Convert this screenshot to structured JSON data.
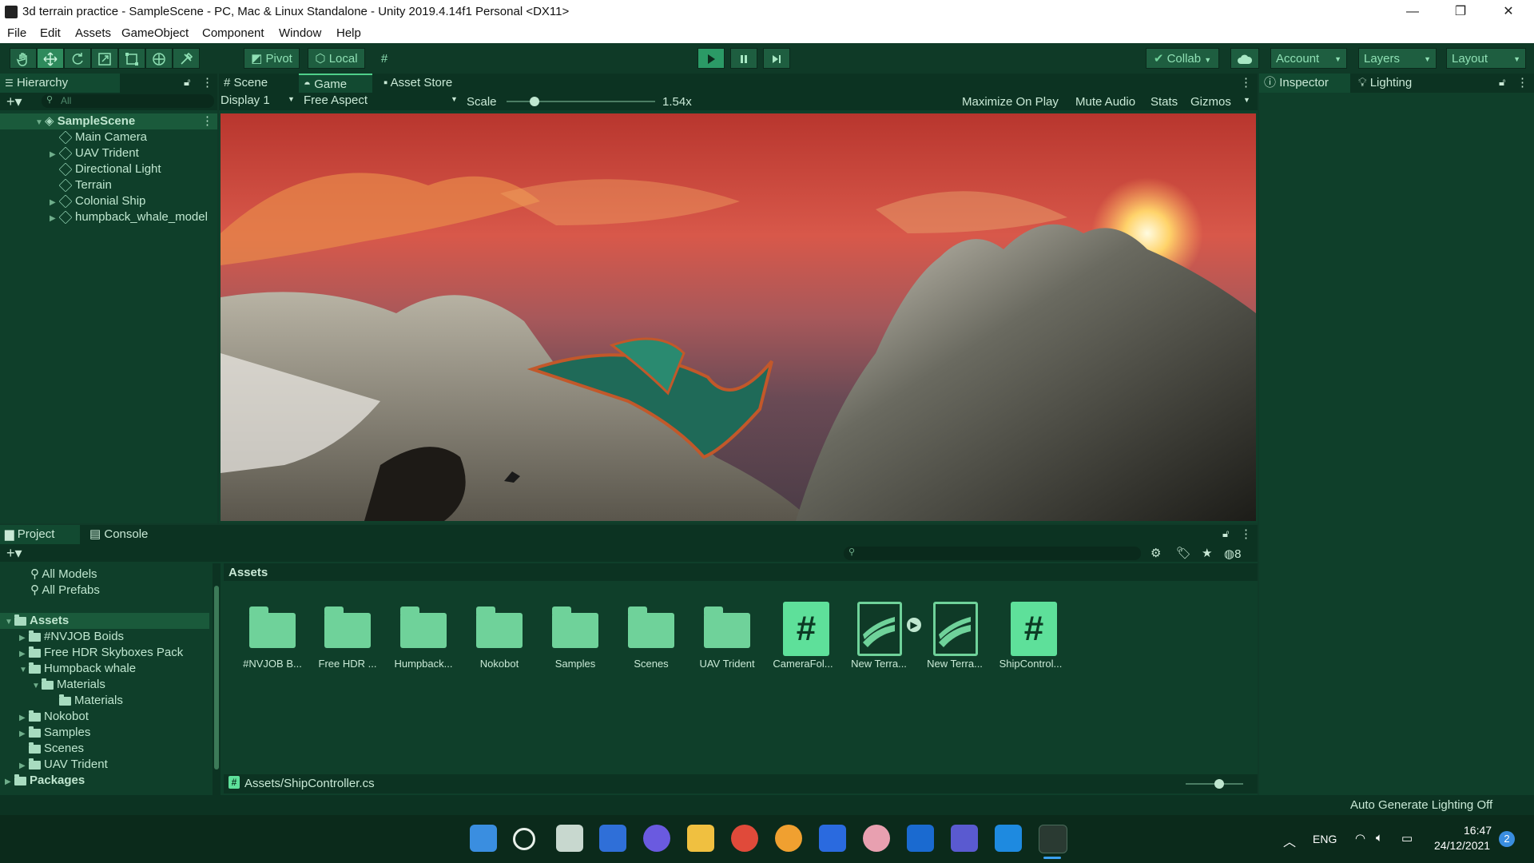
{
  "window": {
    "title": "3d terrain practice - SampleScene - PC, Mac & Linux Standalone - Unity 2019.4.14f1 Personal <DX11>",
    "minimize": "—",
    "restore": "❐",
    "close": "✕"
  },
  "menu": [
    "File",
    "Edit",
    "Assets",
    "GameObject",
    "Component",
    "Window",
    "Help"
  ],
  "toolbar": {
    "pivot": "Pivot",
    "local": "Local",
    "collab": "Collab",
    "account": "Account",
    "layers": "Layers",
    "layout": "Layout"
  },
  "hierarchy": {
    "tab": "Hierarchy",
    "search_placeholder": "All",
    "scene": "SampleScene",
    "items": [
      "Main Camera",
      "UAV Trident",
      "Directional Light",
      "Terrain",
      "Colonial Ship",
      "humpback_whale_model"
    ]
  },
  "center_tabs": {
    "scene": "Scene",
    "game": "Game",
    "asset_store": "Asset Store"
  },
  "game_bar": {
    "display": "Display 1",
    "aspect": "Free Aspect",
    "scale_label": "Scale",
    "scale_value": "1.54x",
    "scale_level": 0.19,
    "maximize": "Maximize On Play",
    "mute": "Mute Audio",
    "stats": "Stats",
    "gizmos": "Gizmos"
  },
  "right_tabs": {
    "inspector": "Inspector",
    "lighting": "Lighting"
  },
  "project": {
    "tab_project": "Project",
    "tab_console": "Console",
    "hidden_count": "8",
    "favorites": [
      "All Models",
      "All Prefabs"
    ],
    "tree": {
      "assets": "Assets",
      "nvjob": "#NVJOB Boids",
      "hdr": "Free HDR Skyboxes Pack",
      "whale": "Humpback whale",
      "materials": "Materials",
      "materials_inner": "Materials",
      "nokobot": "Nokobot",
      "samples": "Samples",
      "scenes": "Scenes",
      "uav": "UAV Trident",
      "packages": "Packages"
    },
    "breadcrumb": "Assets",
    "assets": [
      {
        "label": "#NVJOB B...",
        "kind": "folder"
      },
      {
        "label": "Free HDR ...",
        "kind": "folder"
      },
      {
        "label": "Humpback...",
        "kind": "folder"
      },
      {
        "label": "Nokobot",
        "kind": "folder"
      },
      {
        "label": "Samples",
        "kind": "folder"
      },
      {
        "label": "Scenes",
        "kind": "folder"
      },
      {
        "label": "UAV Trident",
        "kind": "folder"
      },
      {
        "label": "CameraFol...",
        "kind": "script"
      },
      {
        "label": "New Terra...",
        "kind": "terrain"
      },
      {
        "label": "New Terra...",
        "kind": "terrain"
      },
      {
        "label": "ShipControl...",
        "kind": "script"
      }
    ],
    "footer_path": "Assets/ShipController.cs",
    "zoom_level": 0.58
  },
  "statusbar": {
    "text": "Auto Generate Lighting Off"
  },
  "taskbar": {
    "lang": "ENG",
    "time": "16:47",
    "date": "24/12/2021",
    "notifications": "2"
  },
  "colors": {
    "accent": "#2e8a5c",
    "panel": "#0f3f2a",
    "text": "#c9e9d6"
  }
}
